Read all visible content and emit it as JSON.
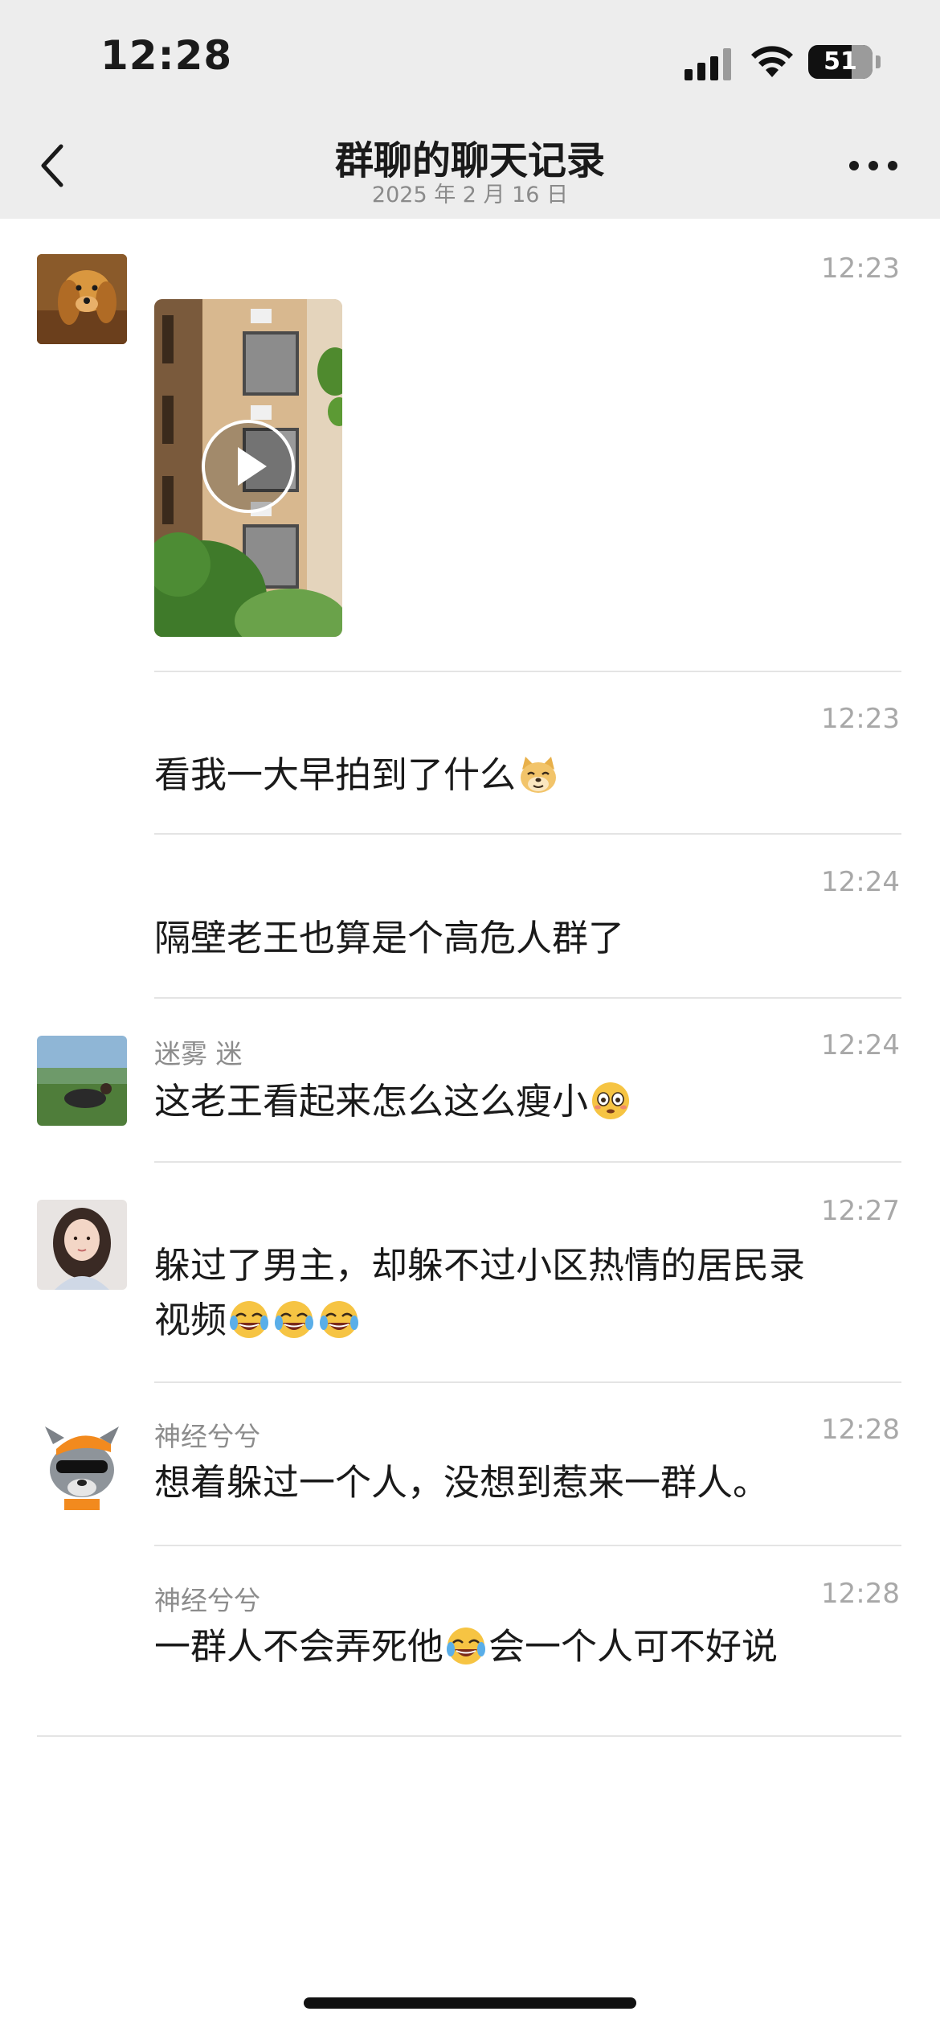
{
  "status_bar": {
    "time": "12:28",
    "battery": "51"
  },
  "header": {
    "title": "群聊的聊天记录",
    "subtitle": "2025 年 2 月 16 日"
  },
  "messages": [
    {
      "sender": "",
      "time": "12:23",
      "type": "video"
    },
    {
      "sender": "",
      "time": "12:23",
      "text": "看我一大早拍到了什么",
      "emojis": [
        "doge"
      ]
    },
    {
      "sender": "",
      "time": "12:24",
      "text": "隔壁老王也算是个高危人群了"
    },
    {
      "sender": "迷雾 迷",
      "time": "12:24",
      "text": "这老王看起来怎么这么瘦小",
      "emojis": [
        "flushed"
      ]
    },
    {
      "sender": "",
      "time": "12:27",
      "text_line1": "躲过了男主，却躲不过小区热情的居民录",
      "text_line2": "视频",
      "emojis": [
        "laugh-cry",
        "laugh-cry",
        "laugh-cry"
      ]
    },
    {
      "sender": "神经兮兮",
      "time": "12:28",
      "text": "想着躲过一个人，没想到惹来一群人。"
    },
    {
      "sender": "神经兮兮",
      "time": "12:28",
      "text_part1": "一群人不会弄死他",
      "text_part2": "会一个人可不好说",
      "emojis": [
        "laugh-cry"
      ]
    }
  ],
  "colors": {
    "header_bg": "#ededed",
    "timestamp": "#a8a8a8",
    "sender": "#8c8c8c",
    "divider": "#e4e4e4"
  }
}
